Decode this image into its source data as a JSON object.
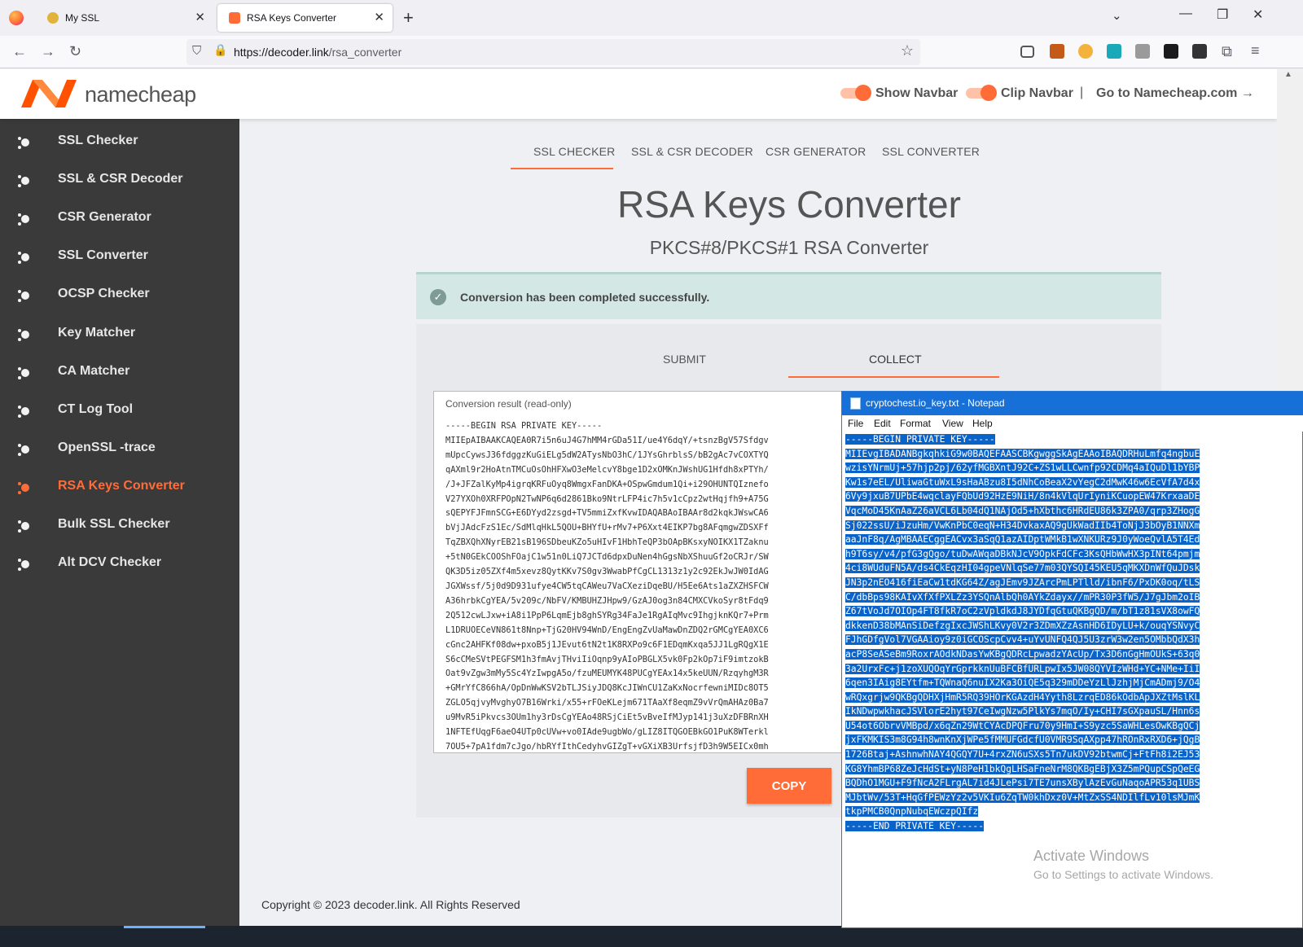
{
  "browser": {
    "tabs": [
      {
        "title": "My SSL"
      },
      {
        "title": "RSA Keys Converter"
      }
    ],
    "url_domain": "https://decoder.link",
    "url_path": "/rsa_converter"
  },
  "header": {
    "logo_text": "namecheap",
    "show_navbar": "Show Navbar",
    "clip_navbar": "Clip Navbar",
    "separator": "|",
    "goto": "Go to Namecheap.com →"
  },
  "sidebar": {
    "items": [
      {
        "label": "SSL Checker"
      },
      {
        "label": "SSL & CSR Decoder"
      },
      {
        "label": "CSR Generator"
      },
      {
        "label": "SSL Converter"
      },
      {
        "label": "OCSP Checker"
      },
      {
        "label": "Key Matcher"
      },
      {
        "label": "CA Matcher"
      },
      {
        "label": "CT Log Tool"
      },
      {
        "label": "OpenSSL -trace"
      },
      {
        "label": "RSA Keys Converter"
      },
      {
        "label": "Bulk SSL Checker"
      },
      {
        "label": "Alt DCV Checker"
      }
    ],
    "active_index": 9
  },
  "page_tabs": [
    "SSL CHECKER",
    "SSL & CSR DECODER",
    "CSR GENERATOR",
    "SSL CONVERTER"
  ],
  "main": {
    "title": "RSA Keys Converter",
    "subtitle": "PKCS#8/PKCS#1 RSA Converter",
    "alert": "Conversion has been completed successfully.",
    "card_tabs": {
      "submit": "SUBMIT",
      "collect": "COLLECT"
    },
    "result_label": "Conversion result (read-only)",
    "result_lines": [
      "-----BEGIN RSA PRIVATE KEY-----",
      "MIIEpAIBAAKCAQEA0R7i5n6uJ4G7hMM4rGDa51I/ue4Y6dqY/+tsnzBgV57Sfdgv",
      "mUpcCywsJ36fdggzKuGiELg5dW2ATysNbO3hC/1JYsGhrblsS/bB2gAc7vCOXTYQ",
      "qAXml9r2HoAtnTMCuOsOhHFXwO3eMelcvY8bge1D2xOMKnJWshUG1Hfdh8xPTYh/",
      "/J+JFZalKyMp4igrqKRFuOyq8WmgxFanDKA+OSpwGmdum1Qi+i29OHUNTQIznefo",
      "V27YXOh0XRFPOpN2TwNP6q6d2861Bko9NtrLFP4ic7h5v1cCpz2wtHqjfh9+A75G",
      "sQEPYFJFmnSCG+E6DYyd2zsgd+TV5mmiZxfKvwIDAQABAoIBAAr8d2kqkJWswCA6",
      "bVjJAdcFzS1Ec/SdMlqHkL5QOU+BHYfU+rMv7+P6Xxt4EIKP7bg8AFqmgwZDSXFf",
      "TqZBXQhXNyrEB21sB196SDbeuKZo5uHIvF1HbhTeQP3bOApBKsxyNOIKX1TZaknu",
      "+5tN0GEkCOOShFOajC1w51n0LiQ7JCTd6dpxDuNen4hGgsNbXShuuGf2oCRJr/SW",
      "QK3D5iz05ZXf4m5xevz8QytKKv7S0gv3WwabPfCgCL1313z1y2c92EkJwJW0IdAG",
      "JGXWssf/5j0d9D931ufye4CW5tqCAWeu7VaCXeziDqeBU/H5Ee6Ats1aZXZHSFCW",
      "A36hrbkCgYEA/5v209c/NbFV/KMBUHZJHpw9/GzAJ0og3n84CMXCVkoSyr8tFdq9",
      "2Q512cwLJxw+iA8i1PpP6LqmEjb8ghSYRg34FaJe1RgAIqMvc9IhgjknKQr7+Prm",
      "L1DRUOECeVN861t8Nnp+TjG20HV94WnD/EngEngZvUaMawDnZDQ2rGMCgYEA0XC6",
      "cGnc2AHFKf08dw+pxoB5j1JEvut6tN2t1K8RXPo9c6F1EDqmKxqa5JJ1LgRQgX1E",
      "S6cCMeSVtPEGFSM1h3fmAvjTHviIiOqnp9yAIoPBGLX5vk0Fp2kOp7iF9imtzokB",
      "Oat9vZgw3mMy5Sc4YzIwpgA5o/fzuMEUMYK48PUCgYEAx14x5keUUN/RzqyhgM3R",
      "+GMrYfC866hA/OpDnWwKSV2bTLJSiyJDQ8KcJIWnCU1ZaKxNocrfewniMIDc8OT5",
      "ZGLO5qjvyMvghyO7B16Wrki/x55+rFOeKLejm671TAaXf8eqmZ9vVrQmAHAz0Ba7",
      "u9MvR5iPkvcs3OUm1hy3rDsCgYEAo48RSjCiEt5vBveIfMJyp141j3uXzDFBRnXH",
      "1NFTEfUqgF6aeO4UTp0cUVw+vo0IAde9ugbWo/gLIZ8ITQGOEBkGO1PuK8WTerkl",
      "7OU5+7pA1fdm7cJgo/hbRYfIthCedyhvGIZgT+vGXiXB3UrfsjfD3h9W5EICx0mh"
    ],
    "copy_label": "COPY",
    "footer": "Copyright © 2023 decoder.link. All Rights Reserved"
  },
  "notepad": {
    "title": "cryptochest.io_key.txt - Notepad",
    "menu": [
      "File",
      "Edit",
      "Format",
      "View",
      "Help"
    ],
    "lines": [
      "-----BEGIN PRIVATE KEY-----",
      "MIIEvgIBADANBgkqhkiG9w0BAQEFAASCBKgwggSkAgEAAoIBAQDRHuLmfq4ngbuE",
      "wzisYNrmUj+57hjp2pj/62yfMGBXntJ92C+ZS1wLLCwnfp92CDMq4aIQuDl1bYBP",
      "Kw1s7eEL/UliwaGtuWxL9sHaABzu8I5dNhCoBeaX2vYegC2dMwK46w6EcVfA7d4x",
      "6Vy9jxuB7UPbE4wqclayFQbUd92HzE9NiH/8n4kVlqUrIyniKCuopEW47KrxaaDE",
      "VqcMoD45KnAaZ26aVCL6Lb04dQ1NAjOd5+hXbthc6HRdEU86k3ZPA0/qrp3ZHogG",
      "Sj022ssU/iJzuHm/VwKnPbC0eqN+H34DvkaxAQ9gUkWadIIb4ToNjJ3bOyB1NNXm",
      "aaJnF8q/AgMBAAECggEACvx3aSqQ1azAIDptWMkB1wXNKURz9J0yWoeQvlA5T4Ed",
      "h9T6sy/v4/pfG3gQgo/tuDwAWqaDBkNJcV9OpkFdCFc3KsQHbWwHX3pINt64pmjm",
      "4ci8WUduFN5A/ds4CkEqzHI04gpeVNlqSe77m03QYSQI45KEU5qMKXDnWfQuJDsk",
      "JN3p2nEO416fiEaCw1tdKG64Z/agJEmv9JZArcPmLPTlld/ibnF6/PxDK0oq/tLS",
      "C/dbBps98KAIvXfXfPXLZz3YSQnAlbQh0AYkZdayx//mPR30P3fW5/J7gJbm2oIB",
      "Z67tVoJd7OIOp4FT8fkR7oC2zVpldkdJ8JYDfqGtuQKBgQD/m/bT1z81sVX8owFQ",
      "dkkenD38bMAnSiDefzgIxcJWShLKvy0V2r3ZDmXZzAsnHD6IDyLU+k/ouqYSNvyC",
      "FJhGDfgVol7VGAAioy9z0iGCOScpCvv4+uYvUNFQ4QJ5U3zrW3w2en5OMbbQdX3h",
      "acP8SeASeBm9RoxrAOdkNDasYwKBgQDRcLpwadzYAcUp/Tx3D6nGgHmOUkS+63q0",
      "3a2UrxFc+j1zoXUQOqYrGprkknUuBFCBfURLpwIx5JW08QYVIzWHd+YC+NMe+IiI",
      "6qen3IAig8EYtfm+TQWnaQ6nuIX2Ka3OiQE5q329mDDeYzLlJzhjMjCmADmj9/O4",
      "wRQxgrjw9QKBgQDHXjHmR5RQ39HOrKGAzdH4Yyth8LzrqED86kOdbApJXZtMslKL",
      "IkNDwpwkhacJSVlorE2hyt97CeIwgNzw5PlkYs7mqO/Iy+CHI7sGXpauSL/Hnn6s",
      "U54ot6ObrvVMBpd/x6qZn29WtCYAcDPQFru70y9HmI+S9yzc5SaWHLesOwKBgQCj",
      "jxFKMKIS3m8G94h8wnKnXjWPe5fMMUFGdcfU0VMR9SqAXpp47hROnRxRXD6+jQgB",
      "1726Btaj+AshnwhNAY4QGQY7U+4rxZN6uSXs5Tn7ukDV92btwmCj+FtFh8i2EJ53",
      "KG8YhmBP68ZeJcHdSt+yN8PeH1bkQgLHSaFneNrM8QKBgEBjX3Z5mPQupCSpQeEG",
      "BQDhO1MGU+F9fNcA2FLrgAL7id4JLePsi7TE7unsXBylAzEvGuNaqoAPR53q1UBS",
      "MJbtWv/53T+HqGfPEWzYz2v5VKIu6ZqTW0khDxz0V+MtZxSS4NDIlfLv10lsMJmK",
      "tkpPMCB0QnpNubqEWczpQIfz",
      "-----END PRIVATE KEY-----"
    ],
    "activate_title": "Activate Windows",
    "activate_sub": "Go to Settings to activate Windows."
  }
}
